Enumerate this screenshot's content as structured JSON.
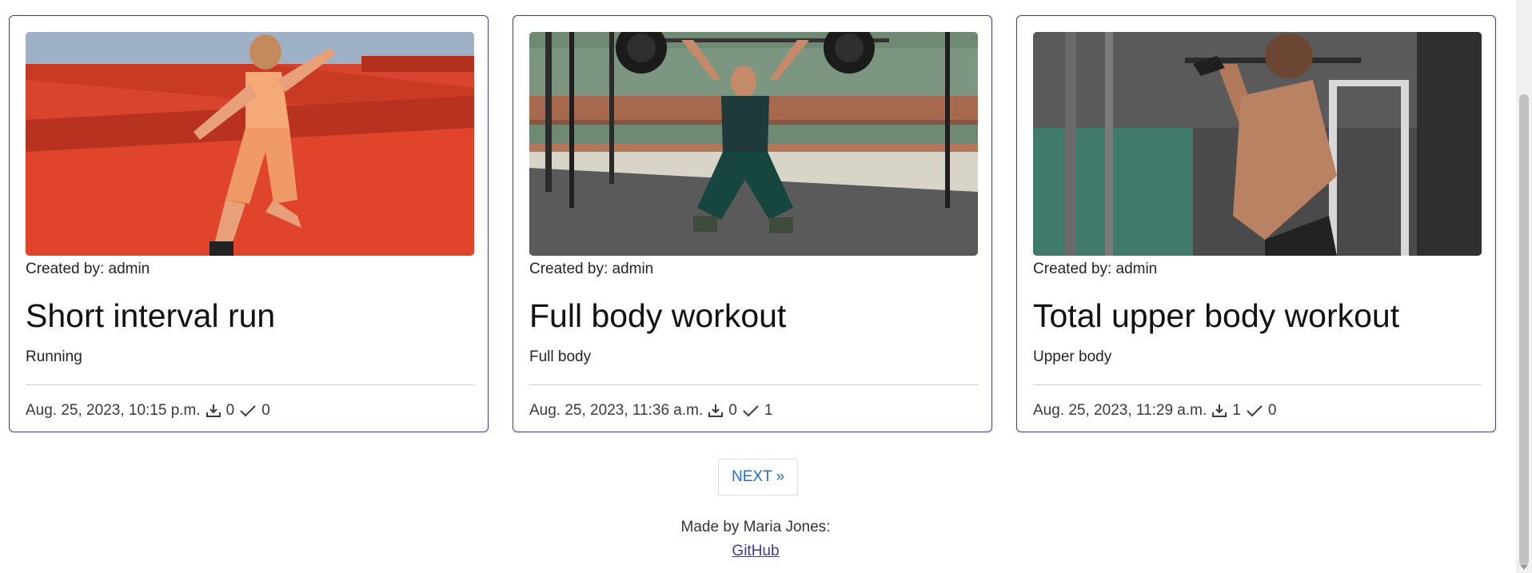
{
  "cards": [
    {
      "created_by": "Created by: admin",
      "title": "Short interval run",
      "category": "Running",
      "date": "Aug. 25, 2023, 10:15 p.m.",
      "downloads": "0",
      "completed": "0"
    },
    {
      "created_by": "Created by: admin",
      "title": "Full body workout",
      "category": "Full body",
      "date": "Aug. 25, 2023, 11:36 a.m.",
      "downloads": "0",
      "completed": "1"
    },
    {
      "created_by": "Created by: admin",
      "title": "Total upper body workout",
      "category": "Upper body",
      "date": "Aug. 25, 2023, 11:29 a.m.",
      "downloads": "1",
      "completed": "0"
    }
  ],
  "pagination": {
    "next_label": "NEXT »"
  },
  "footer": {
    "made_by": "Made by Maria Jones:",
    "link_label": "GitHub"
  },
  "icons": {
    "download": "download-icon",
    "check": "check-icon"
  }
}
